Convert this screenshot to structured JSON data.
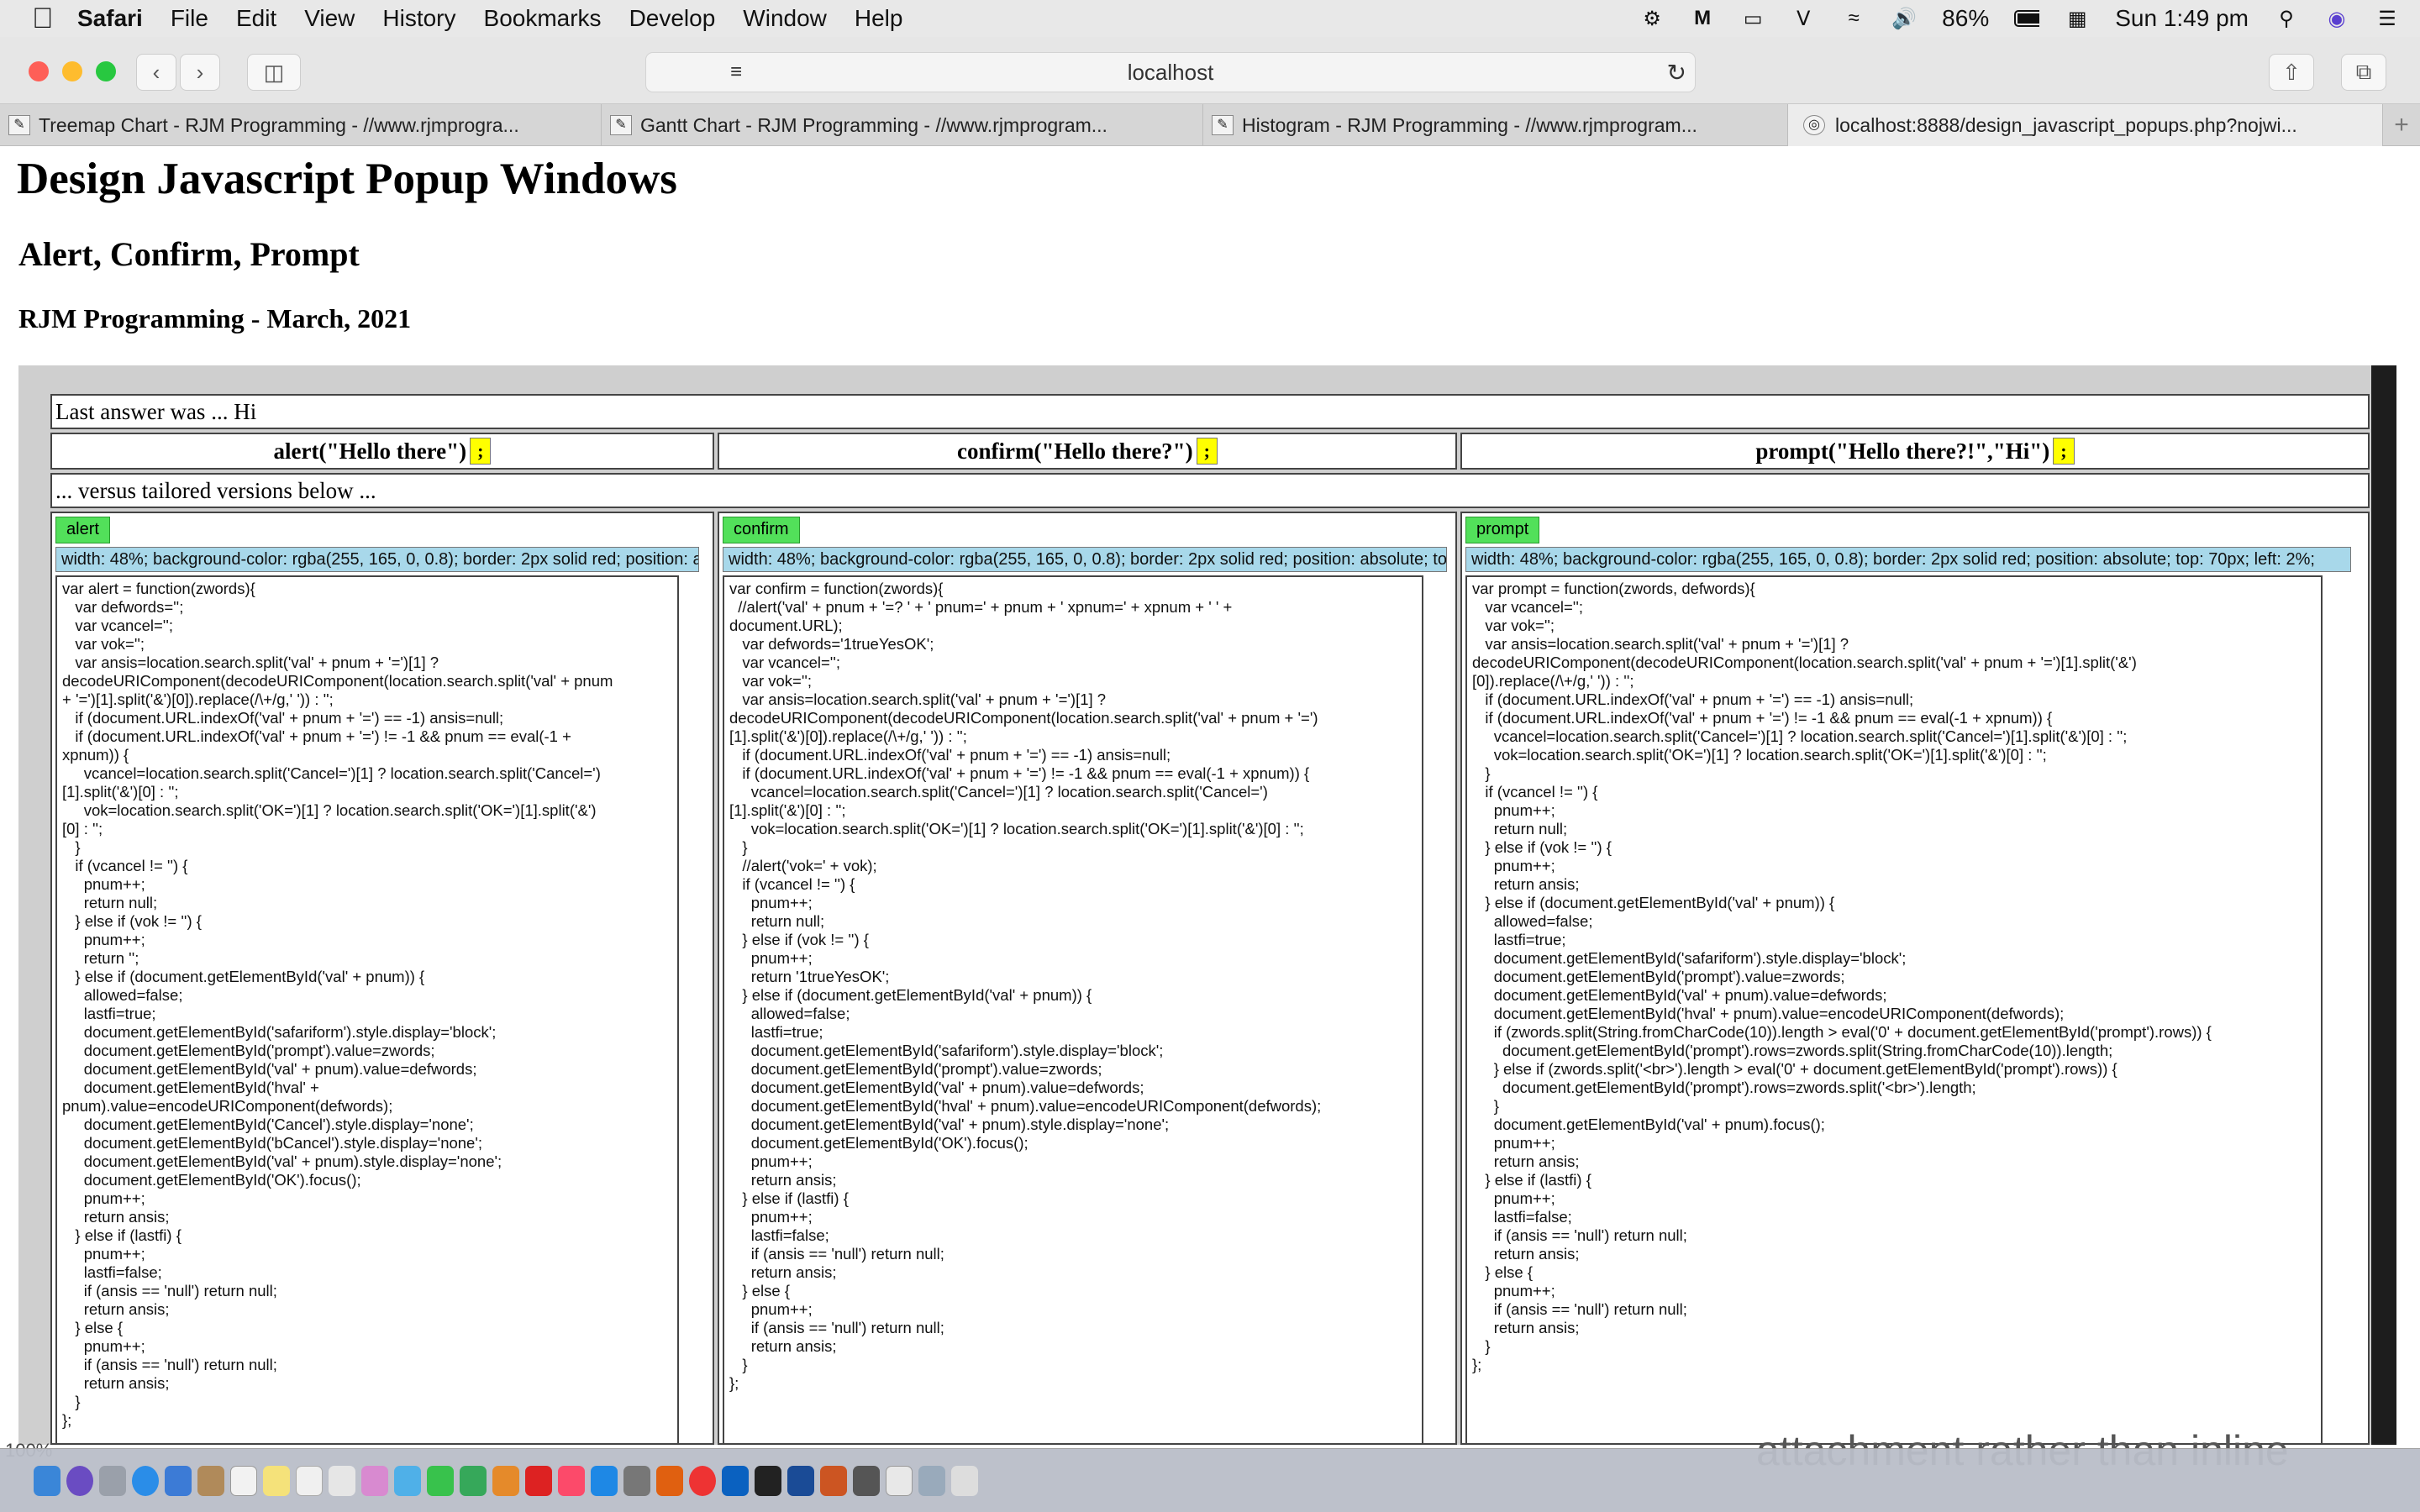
{
  "menubar": {
    "app": "Safari",
    "items": [
      "File",
      "Edit",
      "View",
      "History",
      "Bookmarks",
      "Develop",
      "Window",
      "Help"
    ],
    "battery": "86%",
    "clock": "Sun 1:49 pm"
  },
  "toolbar": {
    "url": "localhost"
  },
  "tabs": [
    {
      "label": "Treemap Chart - RJM Programming - //www.rjmprogra..."
    },
    {
      "label": "Gantt Chart - RJM Programming - //www.rjmprogram..."
    },
    {
      "label": "Histogram - RJM Programming - //www.rjmprogram..."
    },
    {
      "label": "localhost:8888/design_javascript_popups.php?nojwi..."
    }
  ],
  "page": {
    "h1": "Design Javascript Popup Windows",
    "h2": "Alert, Confirm, Prompt",
    "h3": "RJM Programming - March, 2021",
    "last_answer": "Last answer was ... Hi",
    "versus": "... versus tailored versions below ...",
    "semicolon": ";",
    "cols": [
      {
        "header": "alert(\"Hello there\")",
        "button": "alert",
        "style": "width: 48%; background-color: rgba(255, 165, 0, 0.8); border: 2px solid red; position: absolute; top: 70px; left: 2%;",
        "code": "var alert = function(zwords){\n   var defwords='';\n   var vcancel='';\n   var vok='';\n   var ansis=location.search.split('val' + pnum + '=')[1] ?\ndecodeURIComponent(decodeURIComponent(location.search.split('val' + pnum\n+ '=')[1].split('&')[0]).replace(/\\+/g,' ')) : '';\n   if (document.URL.indexOf('val' + pnum + '=') == -1) ansis=null;\n   if (document.URL.indexOf('val' + pnum + '=') != -1 && pnum == eval(-1 +\nxpnum)) {\n     vcancel=location.search.split('Cancel=')[1] ? location.search.split('Cancel=')\n[1].split('&')[0] : '';\n     vok=location.search.split('OK=')[1] ? location.search.split('OK=')[1].split('&')\n[0] : '';\n   }\n   if (vcancel != '') {\n     pnum++;\n     return null;\n   } else if (vok != '') {\n     pnum++;\n     return '';\n   } else if (document.getElementById('val' + pnum)) {\n     allowed=false;\n     lastfi=true;\n     document.getElementById('safariform').style.display='block';\n     document.getElementById('prompt').value=zwords;\n     document.getElementById('val' + pnum).value=defwords;\n     document.getElementById('hval' +\npnum).value=encodeURIComponent(defwords);\n     document.getElementById('Cancel').style.display='none';\n     document.getElementById('bCancel').style.display='none';\n     document.getElementById('val' + pnum).style.display='none';\n     document.getElementById('OK').focus();\n     pnum++;\n     return ansis;\n   } else if (lastfi) {\n     pnum++;\n     lastfi=false;\n     if (ansis == 'null') return null;\n     return ansis;\n   } else {\n     pnum++;\n     if (ansis == 'null') return null;\n     return ansis;\n   }\n};"
      },
      {
        "header": "confirm(\"Hello there?\")",
        "button": "confirm",
        "style": "width: 48%; background-color: rgba(255, 165, 0, 0.8); border: 2px solid red; position: absolute; top: 70px; left: 2%;",
        "code": "var confirm = function(zwords){\n  //alert('val' + pnum + '=? ' + ' pnum=' + pnum + ' xpnum=' + xpnum + ' ' +\ndocument.URL);\n   var defwords='1trueYesOK';\n   var vcancel='';\n   var vok='';\n   var ansis=location.search.split('val' + pnum + '=')[1] ?\ndecodeURIComponent(decodeURIComponent(location.search.split('val' + pnum + '=')\n[1].split('&')[0]).replace(/\\+/g,' ')) : '';\n   if (document.URL.indexOf('val' + pnum + '=') == -1) ansis=null;\n   if (document.URL.indexOf('val' + pnum + '=') != -1 && pnum == eval(-1 + xpnum)) {\n     vcancel=location.search.split('Cancel=')[1] ? location.search.split('Cancel=')\n[1].split('&')[0] : '';\n     vok=location.search.split('OK=')[1] ? location.search.split('OK=')[1].split('&')[0] : '';\n   }\n   //alert('vok=' + vok);\n   if (vcancel != '') {\n     pnum++;\n     return null;\n   } else if (vok != '') {\n     pnum++;\n     return '1trueYesOK';\n   } else if (document.getElementById('val' + pnum)) {\n     allowed=false;\n     lastfi=true;\n     document.getElementById('safariform').style.display='block';\n     document.getElementById('prompt').value=zwords;\n     document.getElementById('val' + pnum).value=defwords;\n     document.getElementById('hval' + pnum).value=encodeURIComponent(defwords);\n     document.getElementById('val' + pnum).style.display='none';\n     document.getElementById('OK').focus();\n     pnum++;\n     return ansis;\n   } else if (lastfi) {\n     pnum++;\n     lastfi=false;\n     if (ansis == 'null') return null;\n     return ansis;\n   } else {\n     pnum++;\n     if (ansis == 'null') return null;\n     return ansis;\n   }\n};"
      },
      {
        "header": "prompt(\"Hello there?!\",\"Hi\")",
        "button": "prompt",
        "style": "width: 48%; background-color: rgba(255, 165, 0, 0.8); border: 2px solid red; position: absolute; top: 70px; left: 2%;",
        "code": "var prompt = function(zwords, defwords){\n   var vcancel='';\n   var vok='';\n   var ansis=location.search.split('val' + pnum + '=')[1] ?\ndecodeURIComponent(decodeURIComponent(location.search.split('val' + pnum + '=')[1].split('&')\n[0]).replace(/\\+/g,' ')) : '';\n   if (document.URL.indexOf('val' + pnum + '=') == -1) ansis=null;\n   if (document.URL.indexOf('val' + pnum + '=') != -1 && pnum == eval(-1 + xpnum)) {\n     vcancel=location.search.split('Cancel=')[1] ? location.search.split('Cancel=')[1].split('&')[0] : '';\n     vok=location.search.split('OK=')[1] ? location.search.split('OK=')[1].split('&')[0] : '';\n   }\n   if (vcancel != '') {\n     pnum++;\n     return null;\n   } else if (vok != '') {\n     pnum++;\n     return ansis;\n   } else if (document.getElementById('val' + pnum)) {\n     allowed=false;\n     lastfi=true;\n     document.getElementById('safariform').style.display='block';\n     document.getElementById('prompt').value=zwords;\n     document.getElementById('val' + pnum).value=defwords;\n     document.getElementById('hval' + pnum).value=encodeURIComponent(defwords);\n     if (zwords.split(String.fromCharCode(10)).length > eval('0' + document.getElementById('prompt').rows)) {\n       document.getElementById('prompt').rows=zwords.split(String.fromCharCode(10)).length;\n     } else if (zwords.split('<br>').length > eval('0' + document.getElementById('prompt').rows)) {\n       document.getElementById('prompt').rows=zwords.split('<br>').length;\n     }\n     document.getElementById('val' + pnum).focus();\n     pnum++;\n     return ansis;\n   } else if (lastfi) {\n     pnum++;\n     lastfi=false;\n     if (ansis == 'null') return null;\n     return ansis;\n   } else {\n     pnum++;\n     if (ansis == 'null') return null;\n     return ansis;\n   }\n};"
      }
    ]
  },
  "status": {
    "zoom": "100%",
    "bg_text": "attachment rather than inline"
  },
  "colors": {
    "button_green": "#52e05a",
    "style_blue": "#a8d8ea",
    "semicolon_yellow": "#ffff00",
    "page_grey": "#cfcfcf"
  }
}
